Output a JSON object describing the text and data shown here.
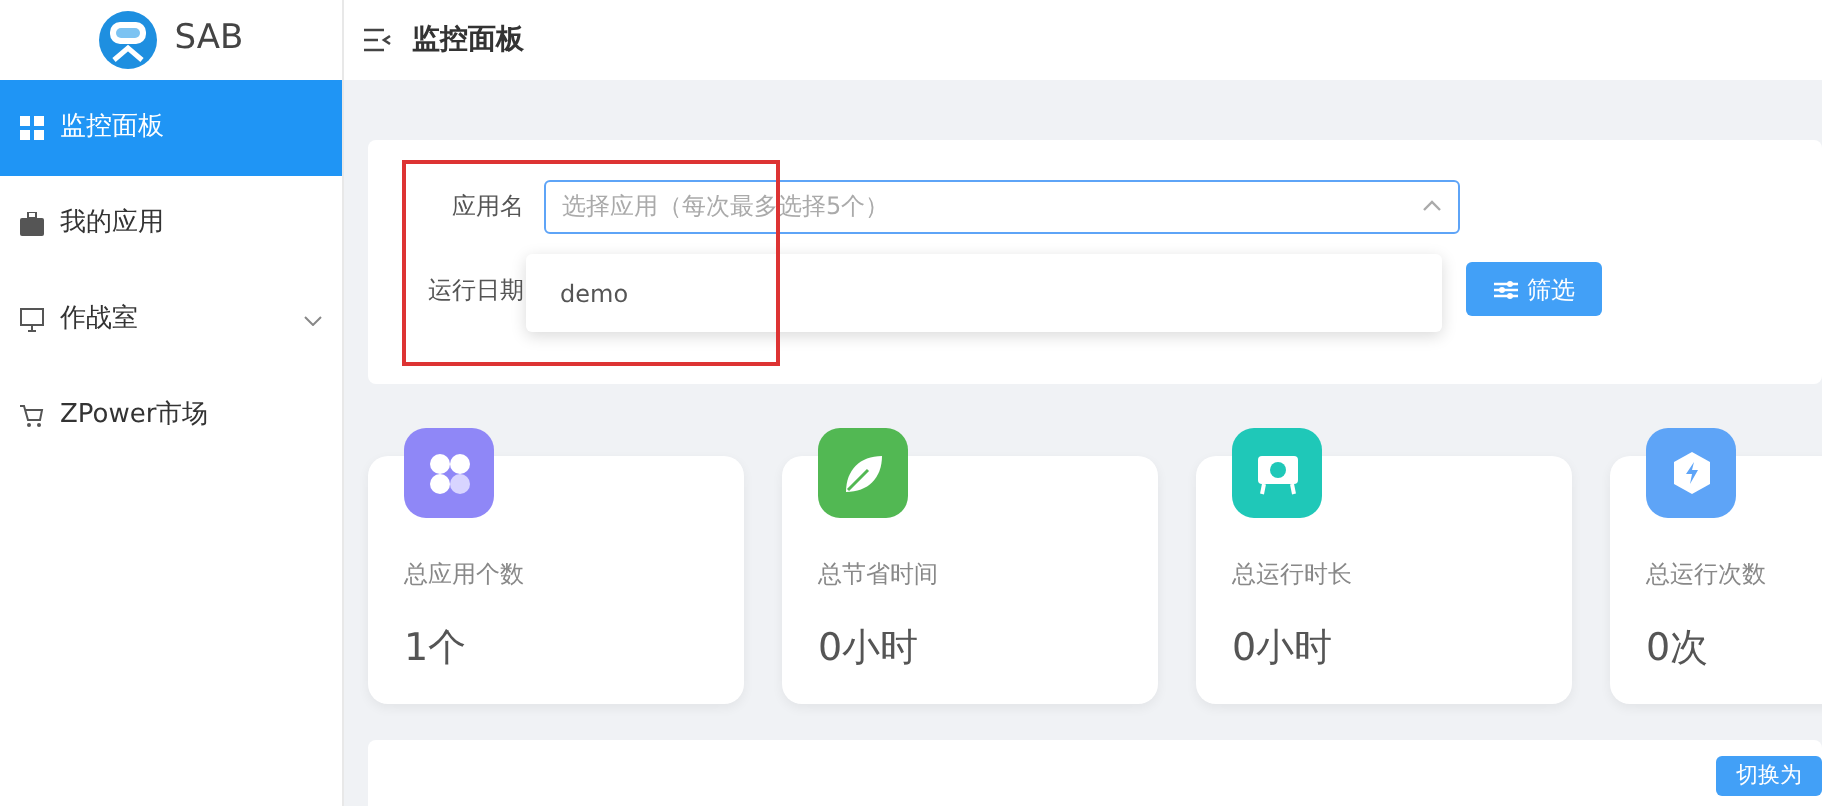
{
  "sidebar": {
    "logo_text": "SAB",
    "items": [
      {
        "label": "监控面板",
        "kind": "grid",
        "selected": true
      },
      {
        "label": "我的应用",
        "kind": "briefcase",
        "selected": false
      },
      {
        "label": "作战室",
        "kind": "monitor",
        "selected": false,
        "expandable": true
      },
      {
        "label": "ZPower市场",
        "kind": "cart",
        "selected": false
      }
    ]
  },
  "header": {
    "title": "监控面板"
  },
  "filter": {
    "app_label": "应用名",
    "app_placeholder": "选择应用（每次最多选择5个）",
    "date_label": "运行日期",
    "dropdown_options": [
      "demo"
    ],
    "filter_button": "筛选"
  },
  "stats": [
    {
      "label": "总应用个数",
      "value": "1个",
      "kind": "apps",
      "color": "#8f87f7"
    },
    {
      "label": "总节省时间",
      "value": "0小时",
      "kind": "leaf",
      "color": "#52b853"
    },
    {
      "label": "总运行时长",
      "value": "0小时",
      "kind": "timer",
      "color": "#1fc8b8"
    },
    {
      "label": "总运行次数",
      "value": "0次",
      "kind": "bolt",
      "color": "#5ea4f7"
    }
  ],
  "bottom_button": "切换为"
}
